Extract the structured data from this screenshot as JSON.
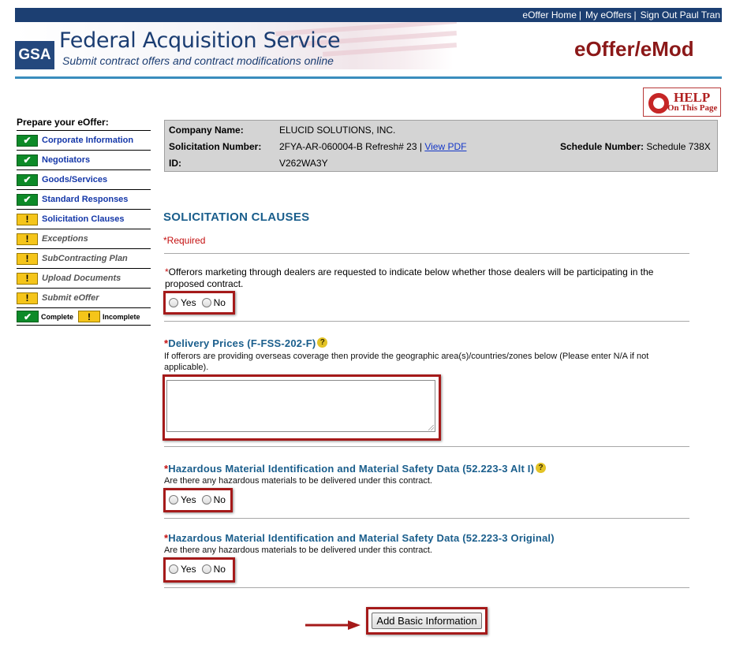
{
  "topnav": {
    "links": [
      "eOffer Home",
      "My eOffers",
      "Sign Out Paul Tran"
    ],
    "separator": "|"
  },
  "banner": {
    "logo_text": "GSA",
    "title": "Federal Acquisition Service",
    "subtitle": "Submit contract offers and contract modifications online",
    "app_title": "eOffer/eMod"
  },
  "help": {
    "line1": "HELP",
    "line2": "On This Page"
  },
  "sidebar": {
    "heading": "Prepare your eOffer:",
    "items": [
      {
        "label": "Corporate Information",
        "status": "complete"
      },
      {
        "label": "Negotiators",
        "status": "complete"
      },
      {
        "label": "Goods/Services",
        "status": "complete"
      },
      {
        "label": "Standard Responses",
        "status": "complete"
      },
      {
        "label": "Solicitation Clauses",
        "status": "incomplete"
      },
      {
        "label": "Exceptions",
        "status": "incomplete"
      },
      {
        "label": "SubContracting Plan",
        "status": "incomplete"
      },
      {
        "label": "Upload Documents",
        "status": "incomplete"
      },
      {
        "label": "Submit eOffer",
        "status": "incomplete"
      }
    ],
    "legend": {
      "complete": "Complete",
      "incomplete": "Incomplete"
    }
  },
  "info": {
    "company_label": "Company Name:",
    "company_value": "ELUCID SOLUTIONS, INC.",
    "solicitation_label": "Solicitation Number:",
    "solicitation_value": "2FYA-AR-060004-B Refresh# 23 |",
    "view_pdf": "View PDF",
    "schedule_label": "Schedule Number:",
    "schedule_value": "Schedule 738X",
    "id_label": "ID:",
    "id_value": "V262WA3Y"
  },
  "main": {
    "section_title": "SOLICITATION CLAUSES",
    "required_note": "*Required",
    "q1": {
      "star": "*",
      "text": "Offerors marketing through dealers are requested to indicate below whether those dealers will be participating in the proposed contract.",
      "yes": "Yes",
      "no": "No"
    },
    "q2": {
      "star": "*",
      "title": "Delivery Prices (F-FSS-202-F)",
      "text": "If offerors are providing overseas coverage then provide the geographic area(s)/countries/zones below (Please enter N/A if not applicable).",
      "textarea_value": ""
    },
    "q3": {
      "star": "*",
      "title": "Hazardous Material Identification and Material Safety Data (52.223-3 Alt I)",
      "text": "Are there any hazardous materials to be delivered under this contract.",
      "yes": "Yes",
      "no": "No"
    },
    "q4": {
      "star": "*",
      "title": "Hazardous Material Identification and Material Safety Data (52.223-3 Original)",
      "text": "Are there any hazardous materials to be delivered under this contract.",
      "yes": "Yes",
      "no": "No"
    },
    "submit_label": "Add Basic Information"
  },
  "colors": {
    "nav": "#1c3f72",
    "accent_red": "#a51a1a",
    "heading_blue": "#1a5e8c",
    "complete_green": "#0d8a28",
    "incomplete_yellow": "#f5c51a"
  }
}
